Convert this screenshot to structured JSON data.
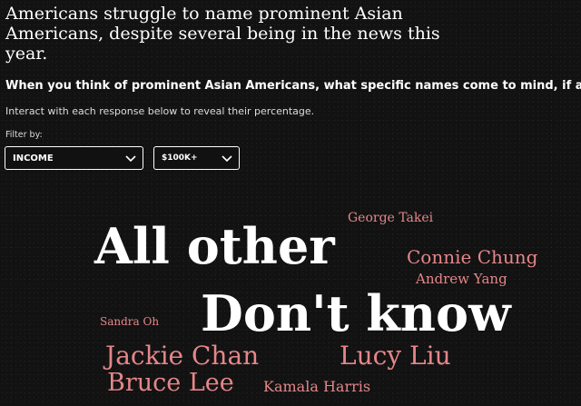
{
  "headline": "Americans struggle to name prominent Asian Americans, despite several being in the news this year.",
  "question": "When you think of prominent Asian Americans, what specific names come to mind, if any?",
  "instruction": "Interact with each response below to reveal their percentage.",
  "filter": {
    "label": "Filter by:",
    "category": "INCOME",
    "bracket": "$100K+"
  },
  "colors": {
    "background": "#121212",
    "text": "#ffffff",
    "accent": "#e5868a"
  },
  "responses": [
    "All other",
    "Don't know",
    "George Takei",
    "Connie Chung",
    "Andrew Yang",
    "Sandra Oh",
    "Jackie Chan",
    "Lucy Liu",
    "Bruce Lee",
    "Kamala Harris"
  ]
}
